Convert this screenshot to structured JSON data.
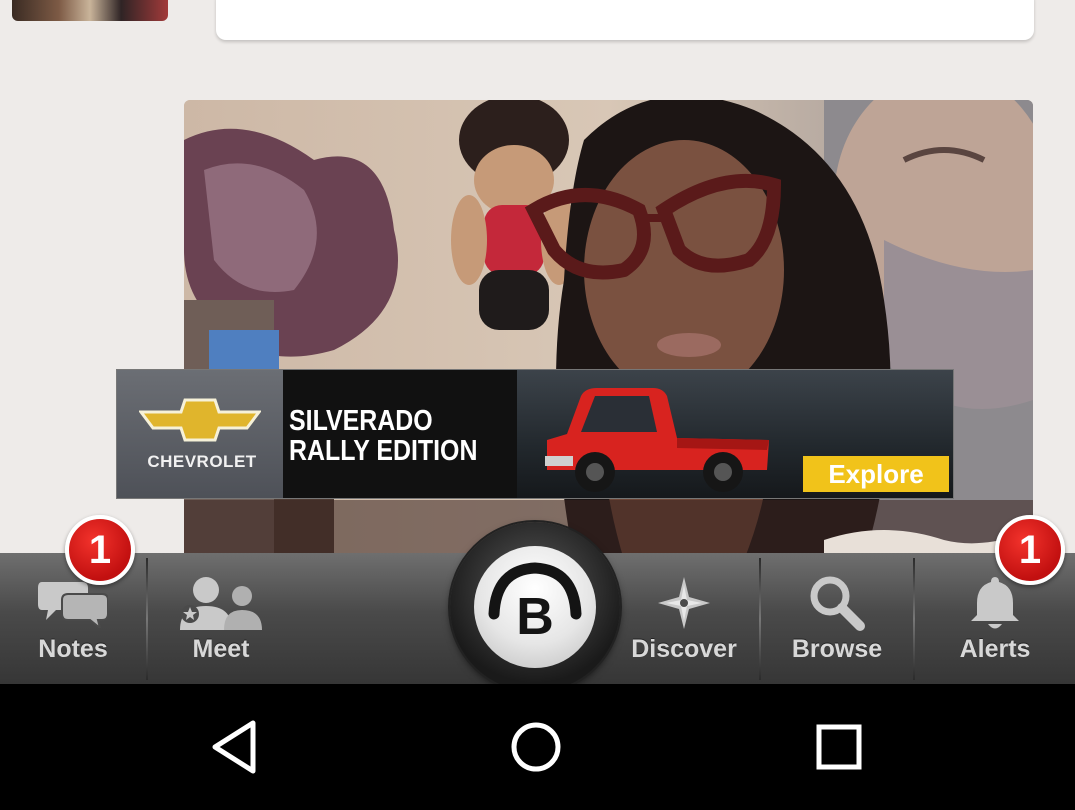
{
  "feed": {
    "avatar_alt": "user avatar",
    "photo_alt": "selfie photo"
  },
  "ad": {
    "brand": "CHEVROLET",
    "headline_line1": "SILVERADO",
    "headline_line2": "RALLY EDITION",
    "cta": "Explore",
    "colors": {
      "cta": "#f1c31a",
      "truck": "#d8231f",
      "bowtie": "#e0b52c"
    }
  },
  "tabbar": {
    "notes": {
      "label": "Notes",
      "badge": "1",
      "icon": "chat-bubbles-icon"
    },
    "meet": {
      "label": "Meet",
      "icon": "people-icon"
    },
    "home": {
      "glyph": "B",
      "icon": "app-logo-icon"
    },
    "discover": {
      "label": "Discover",
      "icon": "compass-star-icon"
    },
    "browse": {
      "label": "Browse",
      "icon": "search-icon"
    },
    "alerts": {
      "label": "Alerts",
      "badge": "1",
      "icon": "bell-icon"
    },
    "colors": {
      "badge": "#d81a16",
      "label": "#d8d8d8"
    }
  },
  "system_nav": {
    "back": "back-icon",
    "home": "home-circle-icon",
    "recents": "recents-square-icon"
  }
}
